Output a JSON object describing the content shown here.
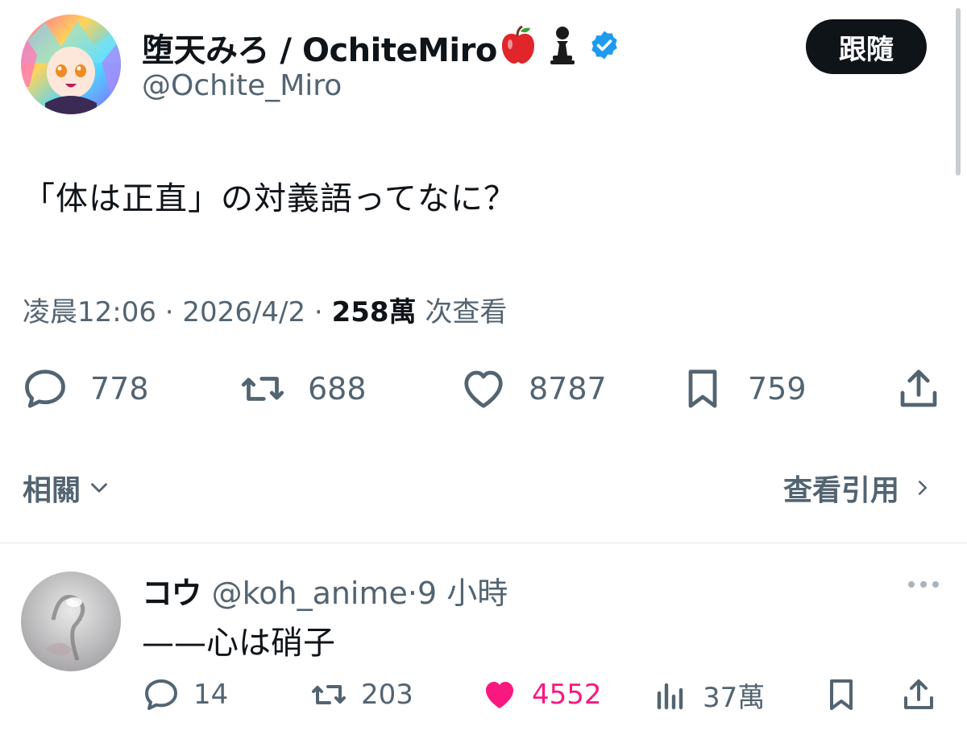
{
  "tweet": {
    "display_name": "堕天みろ / OchiteMiro",
    "badges": [
      "apple-icon",
      "chess-pawn-icon",
      "verified-badge-icon"
    ],
    "handle": "@Ochite_Miro",
    "follow_label": "跟隨",
    "text": "「体は正直」の対義語ってなに？",
    "time": "凌晨12:06",
    "sep": " · ",
    "date": "2026/4/2",
    "views": "258萬",
    "views_label": " 次查看",
    "stats": {
      "replies": "778",
      "retweets": "688",
      "likes": "8787",
      "bookmarks": "759"
    }
  },
  "related": {
    "label": "相關"
  },
  "quotes": {
    "label": "查看引用"
  },
  "reply": {
    "name": "コウ",
    "handle": "@koh_anime",
    "sep": "·",
    "time": "9 小時",
    "text": "——心は硝子",
    "stats": {
      "replies": "14",
      "retweets": "203",
      "likes": "4552",
      "views": "37萬"
    }
  },
  "colors": {
    "text": "#0f1419",
    "muted": "#536471",
    "like": "#f91880",
    "verified": "#1d9bf0"
  }
}
